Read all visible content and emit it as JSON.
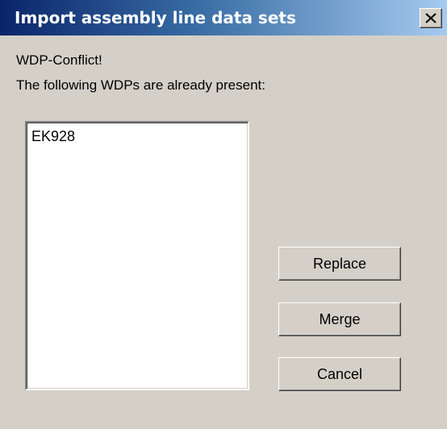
{
  "window": {
    "title": "Import assembly line data sets"
  },
  "message": {
    "line1": "WDP-Conflict!",
    "line2": "The following WDPs are already present:"
  },
  "conflicts": {
    "items": [
      "EK928"
    ]
  },
  "buttons": {
    "replace": "Replace",
    "merge": "Merge",
    "cancel": "Cancel"
  },
  "icons": {
    "close": "close-icon"
  },
  "colors": {
    "titlebar_start": "#0a246a",
    "titlebar_end": "#a6caf0",
    "dialog_face": "#d4d0c8"
  }
}
